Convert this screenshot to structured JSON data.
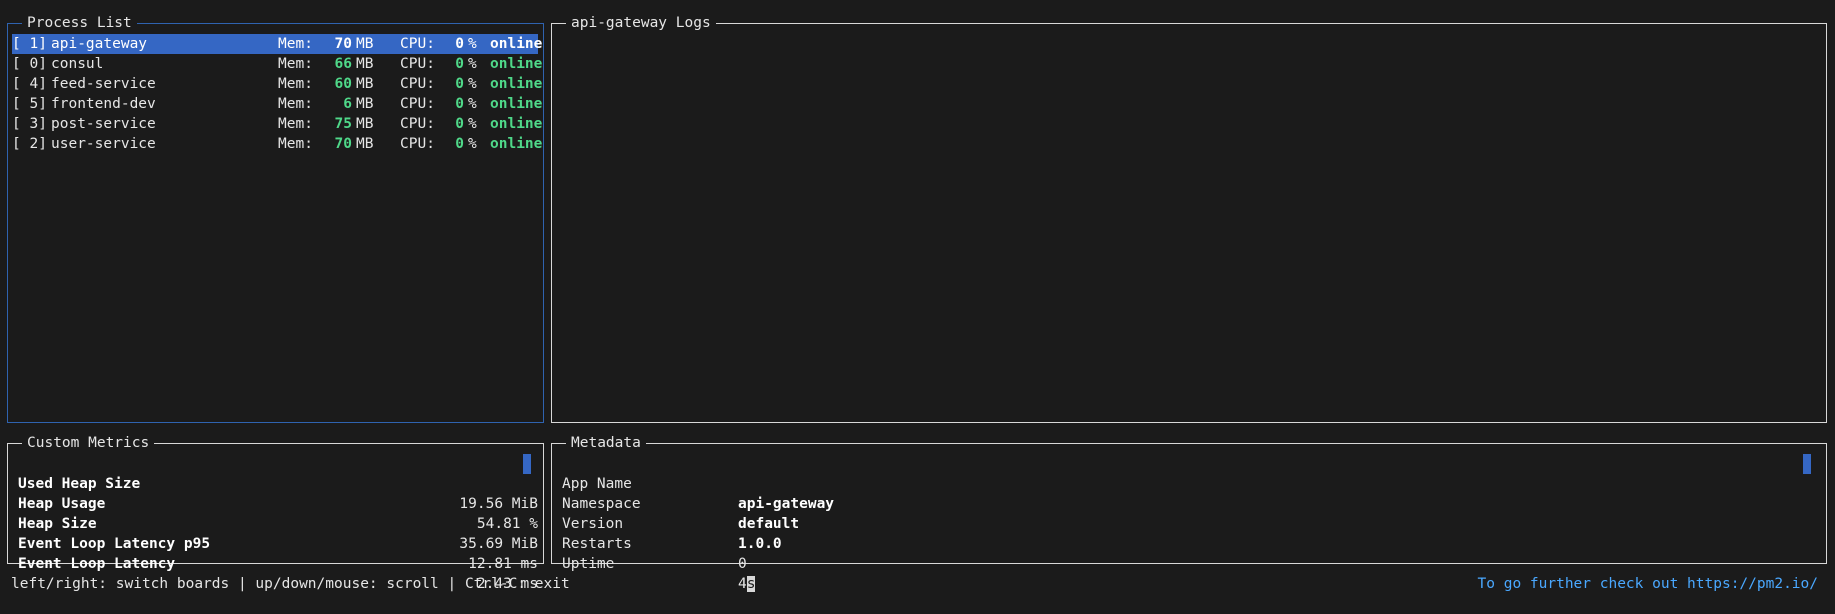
{
  "process_list": {
    "title": "Process List",
    "processes": [
      {
        "id": "[ 1]",
        "name": "api-gateway",
        "mem_label": "Mem:",
        "mem_value": "70",
        "mem_unit": "MB",
        "cpu_label": "CPU:",
        "cpu_value": "0",
        "cpu_unit": "%",
        "status": "online",
        "selected": true
      },
      {
        "id": "[ 0]",
        "name": "consul",
        "mem_label": "Mem:",
        "mem_value": "66",
        "mem_unit": "MB",
        "cpu_label": "CPU:",
        "cpu_value": "0",
        "cpu_unit": "%",
        "status": "online",
        "selected": false
      },
      {
        "id": "[ 4]",
        "name": "feed-service",
        "mem_label": "Mem:",
        "mem_value": "60",
        "mem_unit": "MB",
        "cpu_label": "CPU:",
        "cpu_value": "0",
        "cpu_unit": "%",
        "status": "online",
        "selected": false
      },
      {
        "id": "[ 5]",
        "name": "frontend-dev",
        "mem_label": "Mem:",
        "mem_value": "6",
        "mem_unit": "MB",
        "cpu_label": "CPU:",
        "cpu_value": "0",
        "cpu_unit": "%",
        "status": "online",
        "selected": false
      },
      {
        "id": "[ 3]",
        "name": "post-service",
        "mem_label": "Mem:",
        "mem_value": "75",
        "mem_unit": "MB",
        "cpu_label": "CPU:",
        "cpu_value": "0",
        "cpu_unit": "%",
        "status": "online",
        "selected": false
      },
      {
        "id": "[ 2]",
        "name": "user-service",
        "mem_label": "Mem:",
        "mem_value": "70",
        "mem_unit": "MB",
        "cpu_label": "CPU:",
        "cpu_value": "0",
        "cpu_unit": "%",
        "status": "online",
        "selected": false
      }
    ]
  },
  "logs": {
    "title": "api-gateway Logs"
  },
  "custom_metrics": {
    "title": "Custom Metrics",
    "items": [
      {
        "label": "Used Heap Size",
        "value": "19.56 MiB"
      },
      {
        "label": "Heap Usage",
        "value": "54.81 %"
      },
      {
        "label": "Heap Size",
        "value": "35.69 MiB"
      },
      {
        "label": "Event Loop Latency p95",
        "value": "12.81 ms"
      },
      {
        "label": "Event Loop Latency",
        "value": "2.43 ms"
      }
    ]
  },
  "metadata": {
    "title": "Metadata",
    "items": [
      {
        "key": "App Name",
        "value": "api-gateway"
      },
      {
        "key": "Namespace",
        "value": "default"
      },
      {
        "key": "Version",
        "value": "1.0.0"
      },
      {
        "key": "Restarts",
        "value": "0"
      },
      {
        "key": "Uptime",
        "value_main": "4",
        "value_cursor": "s"
      }
    ]
  },
  "footer": {
    "help": "left/right: switch boards | up/down/mouse: scroll | Ctrl-C: exit",
    "link": "To go further check out https://pm2.io/"
  },
  "colors": {
    "panel_active_border": "#2f63b0",
    "selection": "#3567c4",
    "online": "#4fd889",
    "link": "#4aa8ff",
    "background": "#1b1b1b"
  }
}
